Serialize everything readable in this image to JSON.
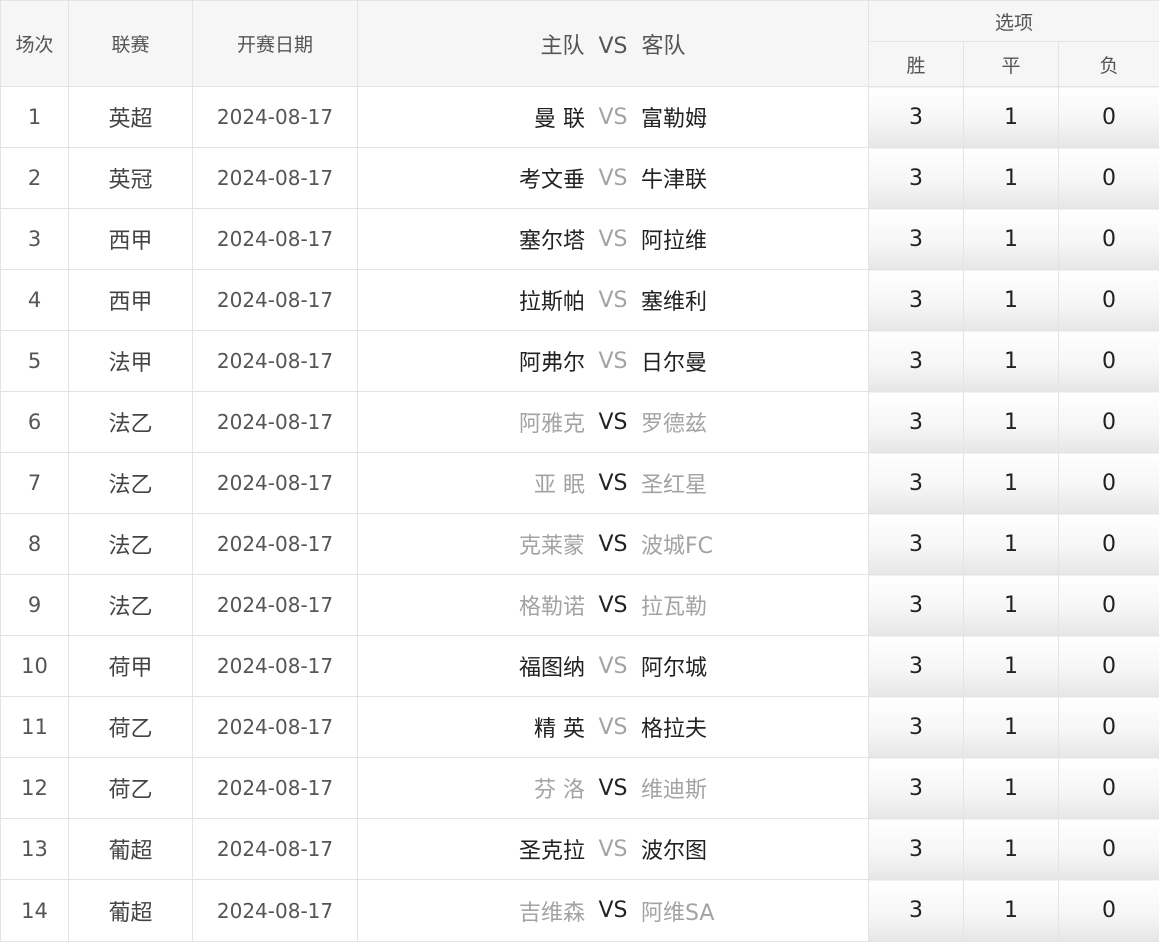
{
  "header": {
    "index": "场次",
    "league": "联赛",
    "date": "开赛日期",
    "home": "主队",
    "vs": "VS",
    "away": "客队",
    "options": "选项",
    "win": "胜",
    "draw": "平",
    "lose": "负"
  },
  "colors": {
    "dark_text": "#222222",
    "light_text": "#a3a3a3",
    "border": "#e4e4e4",
    "header_bg": "#f6f6f6"
  },
  "matches": [
    {
      "no": "1",
      "league": "英超",
      "date": "2024-08-17",
      "home": "曼 联",
      "vs": "VS",
      "away": "富勒姆",
      "teams_muted": false,
      "win": "3",
      "draw": "1",
      "lose": "0"
    },
    {
      "no": "2",
      "league": "英冠",
      "date": "2024-08-17",
      "home": "考文垂",
      "vs": "VS",
      "away": "牛津联",
      "teams_muted": false,
      "win": "3",
      "draw": "1",
      "lose": "0"
    },
    {
      "no": "3",
      "league": "西甲",
      "date": "2024-08-17",
      "home": "塞尔塔",
      "vs": "VS",
      "away": "阿拉维",
      "teams_muted": false,
      "win": "3",
      "draw": "1",
      "lose": "0"
    },
    {
      "no": "4",
      "league": "西甲",
      "date": "2024-08-17",
      "home": "拉斯帕",
      "vs": "VS",
      "away": "塞维利",
      "teams_muted": false,
      "win": "3",
      "draw": "1",
      "lose": "0"
    },
    {
      "no": "5",
      "league": "法甲",
      "date": "2024-08-17",
      "home": "阿弗尔",
      "vs": "VS",
      "away": "日尔曼",
      "teams_muted": false,
      "win": "3",
      "draw": "1",
      "lose": "0"
    },
    {
      "no": "6",
      "league": "法乙",
      "date": "2024-08-17",
      "home": "阿雅克",
      "vs": "VS",
      "away": "罗德兹",
      "teams_muted": true,
      "win": "3",
      "draw": "1",
      "lose": "0"
    },
    {
      "no": "7",
      "league": "法乙",
      "date": "2024-08-17",
      "home": "亚 眠",
      "vs": "VS",
      "away": "圣红星",
      "teams_muted": true,
      "win": "3",
      "draw": "1",
      "lose": "0"
    },
    {
      "no": "8",
      "league": "法乙",
      "date": "2024-08-17",
      "home": "克莱蒙",
      "vs": "VS",
      "away": "波城FC",
      "teams_muted": true,
      "win": "3",
      "draw": "1",
      "lose": "0"
    },
    {
      "no": "9",
      "league": "法乙",
      "date": "2024-08-17",
      "home": "格勒诺",
      "vs": "VS",
      "away": "拉瓦勒",
      "teams_muted": true,
      "win": "3",
      "draw": "1",
      "lose": "0"
    },
    {
      "no": "10",
      "league": "荷甲",
      "date": "2024-08-17",
      "home": "福图纳",
      "vs": "VS",
      "away": "阿尔城",
      "teams_muted": false,
      "win": "3",
      "draw": "1",
      "lose": "0"
    },
    {
      "no": "11",
      "league": "荷乙",
      "date": "2024-08-17",
      "home": "精 英",
      "vs": "VS",
      "away": "格拉夫",
      "teams_muted": false,
      "win": "3",
      "draw": "1",
      "lose": "0"
    },
    {
      "no": "12",
      "league": "荷乙",
      "date": "2024-08-17",
      "home": "芬 洛",
      "vs": "VS",
      "away": "维迪斯",
      "teams_muted": true,
      "win": "3",
      "draw": "1",
      "lose": "0"
    },
    {
      "no": "13",
      "league": "葡超",
      "date": "2024-08-17",
      "home": "圣克拉",
      "vs": "VS",
      "away": "波尔图",
      "teams_muted": false,
      "win": "3",
      "draw": "1",
      "lose": "0"
    },
    {
      "no": "14",
      "league": "葡超",
      "date": "2024-08-17",
      "home": "吉维森",
      "vs": "VS",
      "away": "阿维SA",
      "teams_muted": true,
      "win": "3",
      "draw": "1",
      "lose": "0"
    }
  ]
}
